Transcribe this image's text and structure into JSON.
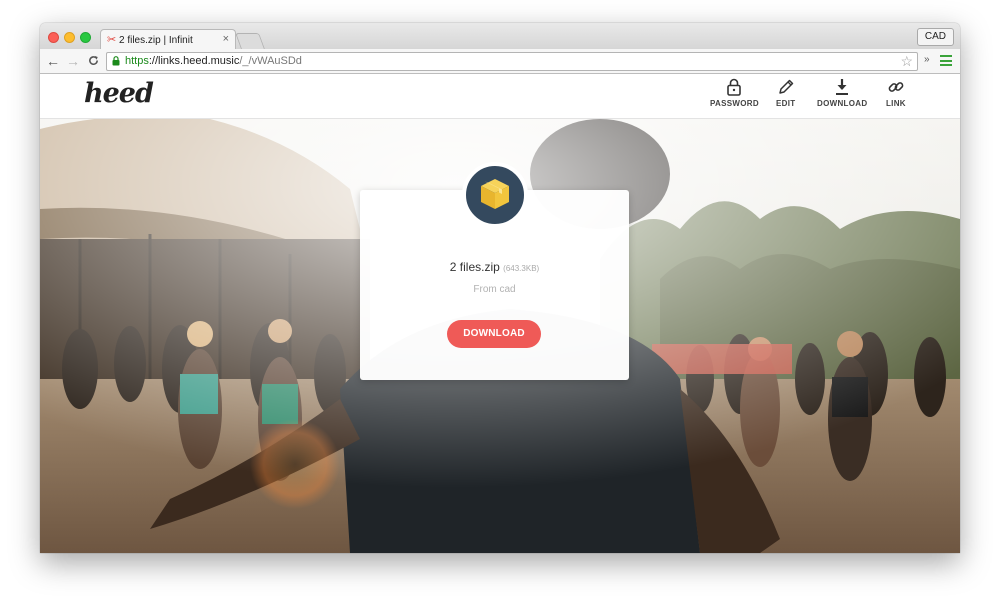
{
  "browser": {
    "tab": {
      "title": "2 files.zip | Infinit",
      "close": "×"
    },
    "profile": "CAD",
    "nav": {
      "back": "←",
      "forward": "→",
      "reload": "C"
    },
    "url": {
      "scheme": "https",
      "separator": "://",
      "host": "links.heed.music",
      "path": "/_/vWAuSDd"
    },
    "bookmark_star": "☆",
    "extensions": "»"
  },
  "site": {
    "logo": "heed",
    "nav": [
      {
        "label": "PASSWORD",
        "icon": "lock-icon"
      },
      {
        "label": "EDIT",
        "icon": "pencil-icon"
      },
      {
        "label": "DOWNLOAD",
        "icon": "download-icon"
      },
      {
        "label": "LINK",
        "icon": "link-icon"
      }
    ]
  },
  "file": {
    "icon": "package-box-icon",
    "name": "2 files.zip",
    "size": "(643.3KB)",
    "from": "From cad",
    "download_label": "DOWNLOAD"
  },
  "colors": {
    "accent": "#ef5a57",
    "badge": "#34495e",
    "box": "#f2c53d",
    "secure": "#1b8a1b"
  }
}
